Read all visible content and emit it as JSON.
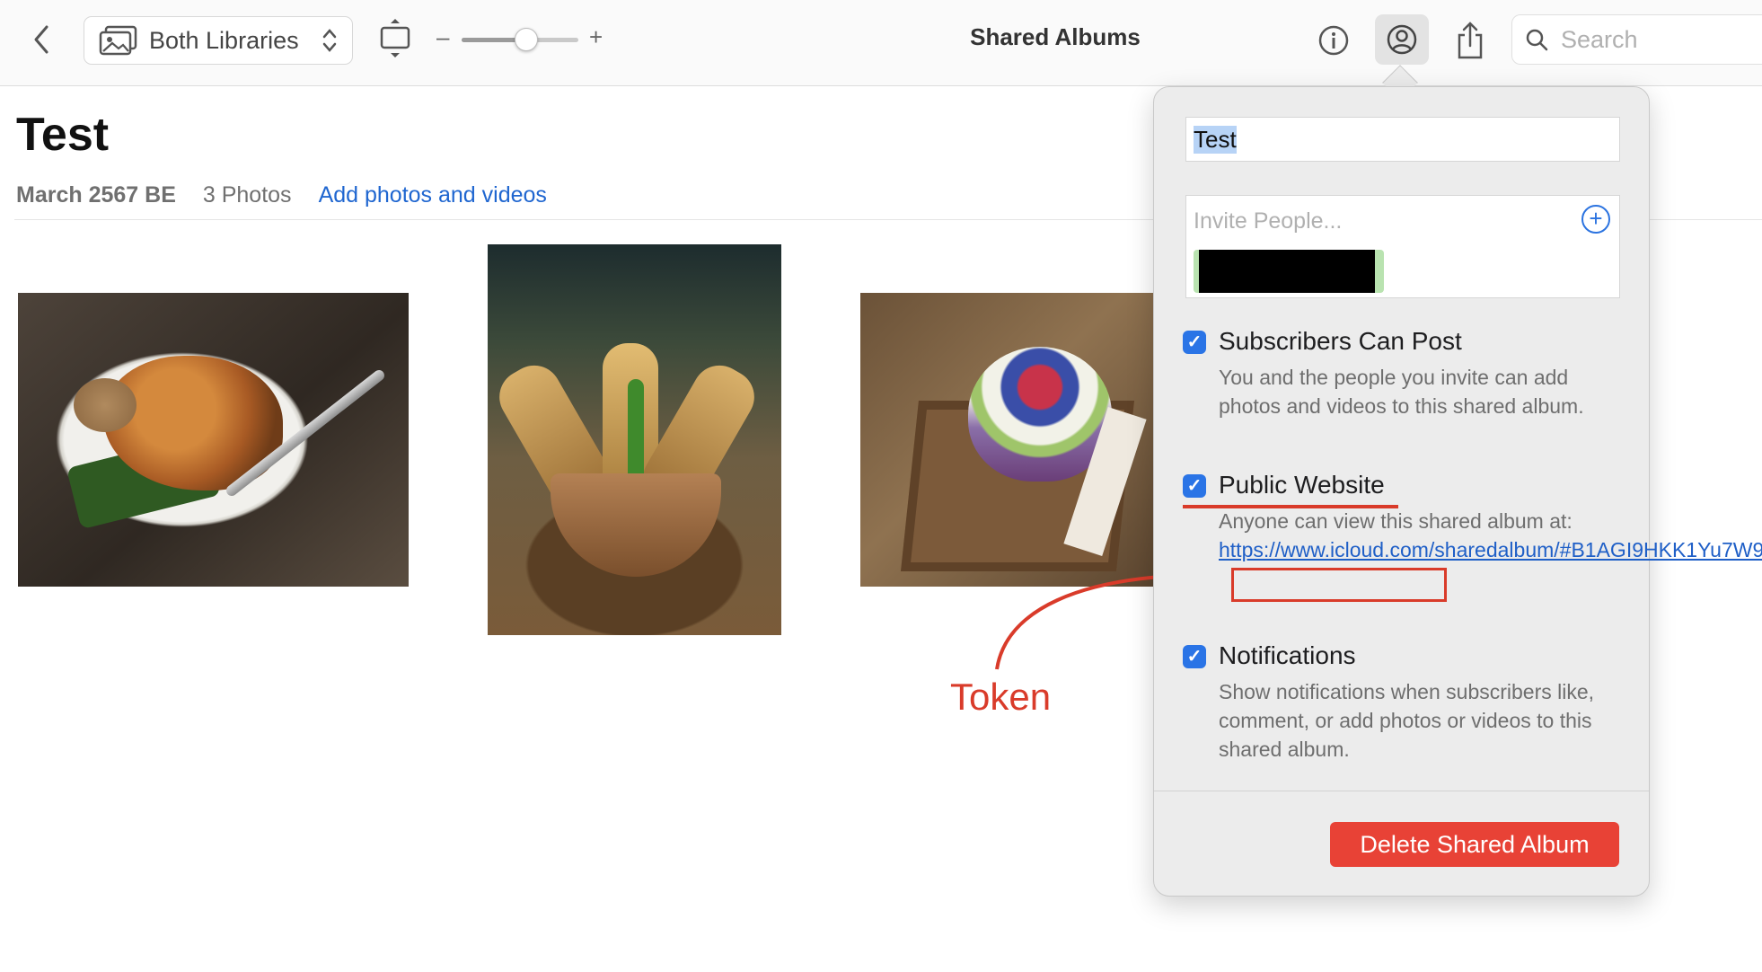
{
  "toolbar": {
    "library_selector": "Both Libraries",
    "window_title": "Shared Albums",
    "search_placeholder": "Search",
    "zoom_level": 0.55
  },
  "album": {
    "title": "Test",
    "date": "March 2567 BE",
    "photo_count": "3 Photos",
    "add_link": "Add photos and videos"
  },
  "popover": {
    "album_name": "Test",
    "invite_placeholder": "Invite People...",
    "options": [
      {
        "title": "Subscribers Can Post",
        "checked": true,
        "description": "You and the people you invite can add photos and videos to this shared album."
      },
      {
        "title": "Public Website",
        "checked": true,
        "description": "Anyone can view this shared album at:",
        "link": "https://www.icloud.com/sharedalbum/#B1AGI9HKK1Yu7W9"
      },
      {
        "title": "Notifications",
        "checked": true,
        "description": "Show notifications when subscribers like, comment, or add photos or videos to this shared album."
      }
    ],
    "delete_button": "Delete Shared Album"
  },
  "annotation": {
    "label": "Token",
    "color": "#d93b2a"
  },
  "colors": {
    "accent": "#2a74e6",
    "link": "#1f5fc7",
    "danger": "#e84236"
  }
}
